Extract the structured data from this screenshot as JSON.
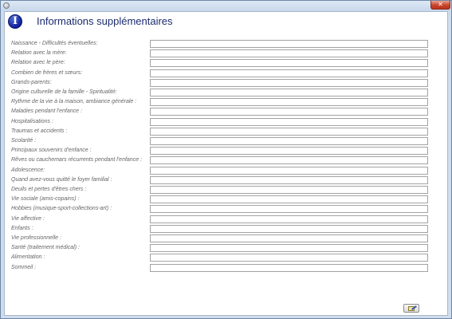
{
  "window": {
    "close_glyph": "✕"
  },
  "header": {
    "title": "Informations supplémentaires",
    "icon": "info-icon",
    "icon_glyph": "I"
  },
  "form": {
    "fields": [
      {
        "id": "naissance",
        "label": "Naissance - Difficultés éventuelles:",
        "value": ""
      },
      {
        "id": "relation-mere",
        "label": "Relation avec la mère:",
        "value": ""
      },
      {
        "id": "relation-pere",
        "label": "Relation avec le père:",
        "value": ""
      },
      {
        "id": "freres-soeurs",
        "label": "Combien de frères et sœurs:",
        "value": ""
      },
      {
        "id": "grands-parents",
        "label": "Grands-parents:",
        "value": ""
      },
      {
        "id": "origine-culturelle",
        "label": "Origine culturelle de la famille - Spiritualité:",
        "value": ""
      },
      {
        "id": "rythme-vie",
        "label": "Rythme de la vie à la maison, ambiance générale :",
        "value": ""
      },
      {
        "id": "maladies-enfance",
        "label": "Maladies pendant l'enfance :",
        "value": ""
      },
      {
        "id": "hospitalisations",
        "label": "Hospitalisations  :",
        "value": ""
      },
      {
        "id": "traumas",
        "label": "Traumas et accidents :",
        "value": ""
      },
      {
        "id": "scolarite",
        "label": "Scolarité :",
        "value": ""
      },
      {
        "id": "souvenirs",
        "label": "Principaux souvenirs d'enfance :",
        "value": ""
      },
      {
        "id": "reves",
        "label": "Rêves ou cauchemars récurrents pendant l'enfance :",
        "value": ""
      },
      {
        "id": "adolescence",
        "label": "Adolescence:",
        "value": ""
      },
      {
        "id": "foyer-familial",
        "label": "Quand avez-vous quitté le foyer familial :",
        "value": ""
      },
      {
        "id": "deuils",
        "label": "Deuils et pertes d'êtres chers :",
        "value": ""
      },
      {
        "id": "vie-sociale",
        "label": "Vie sociale (amis-copains) :",
        "value": ""
      },
      {
        "id": "hobbies",
        "label": "Hobbies (musique-sport-collections-art) :",
        "value": ""
      },
      {
        "id": "vie-affective",
        "label": "Vie affective :",
        "value": ""
      },
      {
        "id": "enfants",
        "label": "Enfants :",
        "value": ""
      },
      {
        "id": "vie-professionnelle",
        "label": "Vie professionnelle :",
        "value": ""
      },
      {
        "id": "sante",
        "label": "Santé (traitement médical) :",
        "value": ""
      },
      {
        "id": "alimentation",
        "label": "Alimentation :",
        "value": ""
      },
      {
        "id": "sommeil",
        "label": "Sommeil :",
        "value": ""
      }
    ]
  },
  "footer": {
    "ok_button_icon": "edit-document-icon"
  }
}
